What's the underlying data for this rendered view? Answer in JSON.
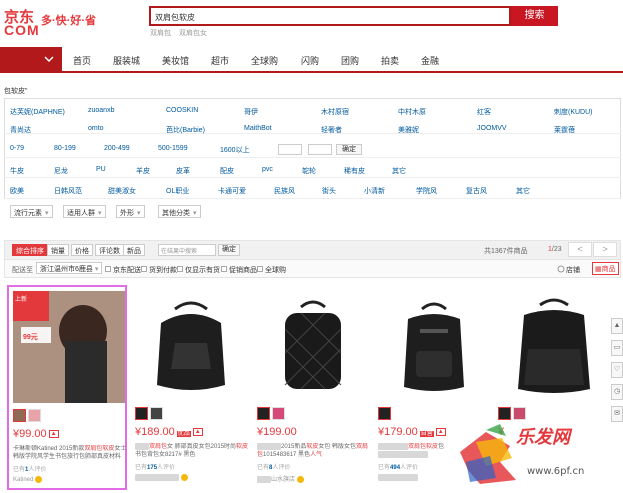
{
  "header": {
    "logo_cn": "京东",
    "logo_en": "COM",
    "slogan": "多·快·好·省",
    "search_value": "双肩包软皮",
    "search_button": "搜索",
    "hot_words": [
      "双肩包",
      "双肩包女"
    ]
  },
  "nav": {
    "items": [
      "首页",
      "服装城",
      "美妆馆",
      "超市",
      "全球购",
      "闪购",
      "团购",
      "拍卖",
      "金融"
    ]
  },
  "breadcrumb": "包软皮\"",
  "filters": {
    "brands_row1": [
      "达芙妮(DAPHNE)",
      "zuoanxb",
      "COOSKIN",
      "哥伊",
      "木村原宿",
      "中村木原",
      "红客",
      "刺度(KUDU)"
    ],
    "brands_row2": [
      "青尚达",
      "omto",
      "芭比(Barbie)",
      "MaithBot",
      "轻奢者",
      "美雅妮",
      "JOOMVV",
      "莱霆蓓"
    ],
    "price": [
      "0-79",
      "80-199",
      "200-499",
      "500-1599",
      "1600以上"
    ],
    "price_confirm": "确定",
    "material": [
      "牛皮",
      "尼龙",
      "PU",
      "羊皮",
      "皮革",
      "配皮",
      "pvc",
      "鸵轮",
      "稀有皮",
      "其它"
    ],
    "style": [
      "欧美",
      "日韩风范",
      "甜美淑女",
      "OL职业",
      "卡通可爱",
      "民族风",
      "街头",
      "小清新",
      "学院风",
      "复古风",
      "其它"
    ],
    "dropdowns": [
      "流行元素",
      "适用人群",
      "外形",
      "其他分类"
    ]
  },
  "sort": {
    "buttons": [
      "综合排序",
      "销量",
      "价格",
      "评论数",
      "新品"
    ],
    "search_in_placeholder": "在结果中搜索",
    "search_in_btn": "确定",
    "total": "共1367件商品",
    "page_current": "1",
    "page_total": "/23",
    "prev": "<",
    "next": ">"
  },
  "delivery": {
    "label": "配送至",
    "area": "浙江温州市6鹿县",
    "options": [
      "京东配送",
      "货到付款",
      "仅显示有货",
      "促销商品",
      "全球购"
    ],
    "view_shop": "店铺",
    "view_goods": "商品"
  },
  "products": [
    {
      "price": "¥99.00",
      "title_a": "卡琳斯顿Katined 2015新款",
      "title_hl": "双肩包软皮",
      "title_b": "女士韩版学院风学生书包旅行包肺部真皮材料",
      "comments": "1",
      "comment_suffix": "人评价",
      "shop": "Katined",
      "promo1": "上新",
      "promo2": "99元"
    },
    {
      "price": "¥189.00",
      "tag": "优品",
      "title_a": "",
      "title_hl": "双肩包",
      "title_b": "女 肺部真皮女包2015时尚",
      "title_c": "软皮",
      "title_d": "书包背包女8217# 黑色",
      "comments": "175",
      "comment_suffix": "人评价",
      "shop": ""
    },
    {
      "price": "¥199.00",
      "title_a": "2015新品",
      "title_hl": "软皮",
      "title_b": "女包 韩版女包",
      "title_c": "双肩包",
      "title_d": "1015483617 黑色",
      "hot": "人气",
      "comments": "8",
      "comment_suffix": "人评价",
      "shop": "山水旗店"
    },
    {
      "price": "¥179.00",
      "tag": "自营",
      "title_a": "",
      "title_hl": "双肩包软皮",
      "title_b": "包",
      "comments": "494",
      "comment_suffix": "人评价",
      "shop": ""
    },
    {
      "price": "¥",
      "title_a": "",
      "title_hl": "",
      "title_b": "",
      "comments": "",
      "comment_suffix": "",
      "shop": ""
    }
  ],
  "watermark": {
    "text": "乐发网",
    "url": "www.6pf.cn"
  },
  "colors": {
    "brand_red": "#e4393c",
    "dark_red": "#b1191a",
    "link_blue": "#005aa0",
    "highlight_pink": "#e26ce3"
  }
}
